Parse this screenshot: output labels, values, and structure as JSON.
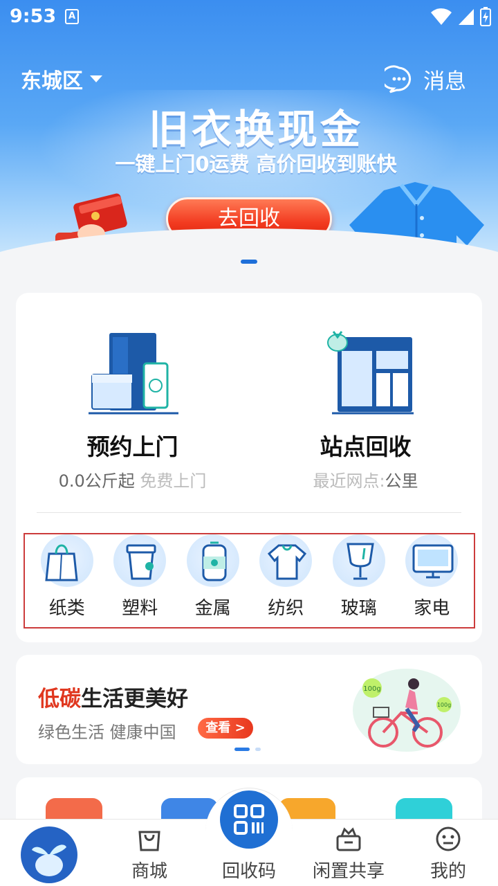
{
  "status_bar": {
    "time": "9:53",
    "notification_glyph": "A"
  },
  "header": {
    "location": "东城区",
    "message_label": "消息"
  },
  "banner": {
    "title": "旧衣换现金",
    "subtitle": "一键上门0运费 高价回收到账快",
    "cta_label": "去回收"
  },
  "services": [
    {
      "title": "预约上门",
      "sub_dark": "0.0公斤起",
      "sub_light": " 免费上门"
    },
    {
      "title": "站点回收",
      "sub_dark": "最近网点:",
      "sub_light_after": "公里"
    }
  ],
  "categories": [
    {
      "label": "纸类",
      "icon": "paper-bag-icon"
    },
    {
      "label": "塑料",
      "icon": "plastic-cup-icon"
    },
    {
      "label": "金属",
      "icon": "metal-can-icon"
    },
    {
      "label": "纺织",
      "icon": "textile-shirt-icon"
    },
    {
      "label": "玻璃",
      "icon": "glass-cup-icon"
    },
    {
      "label": "家电",
      "icon": "appliance-monitor-icon"
    }
  ],
  "promo": {
    "title_highlight": "低碳",
    "title_rest": "生活更美好",
    "subtitle": "绿色生活 健康中国",
    "button_label": "查看 >",
    "badge_1": "100g",
    "badge_2": "100g"
  },
  "bottom_nav": {
    "home_label": "",
    "shop_label": "商城",
    "code_label": "回收码",
    "share_label": "闲置共享",
    "mine_label": "我的"
  },
  "colors": {
    "brand_blue": "#1f6fd3",
    "accent_red": "#e0371f",
    "highlight_border": "#cc3b3b"
  }
}
